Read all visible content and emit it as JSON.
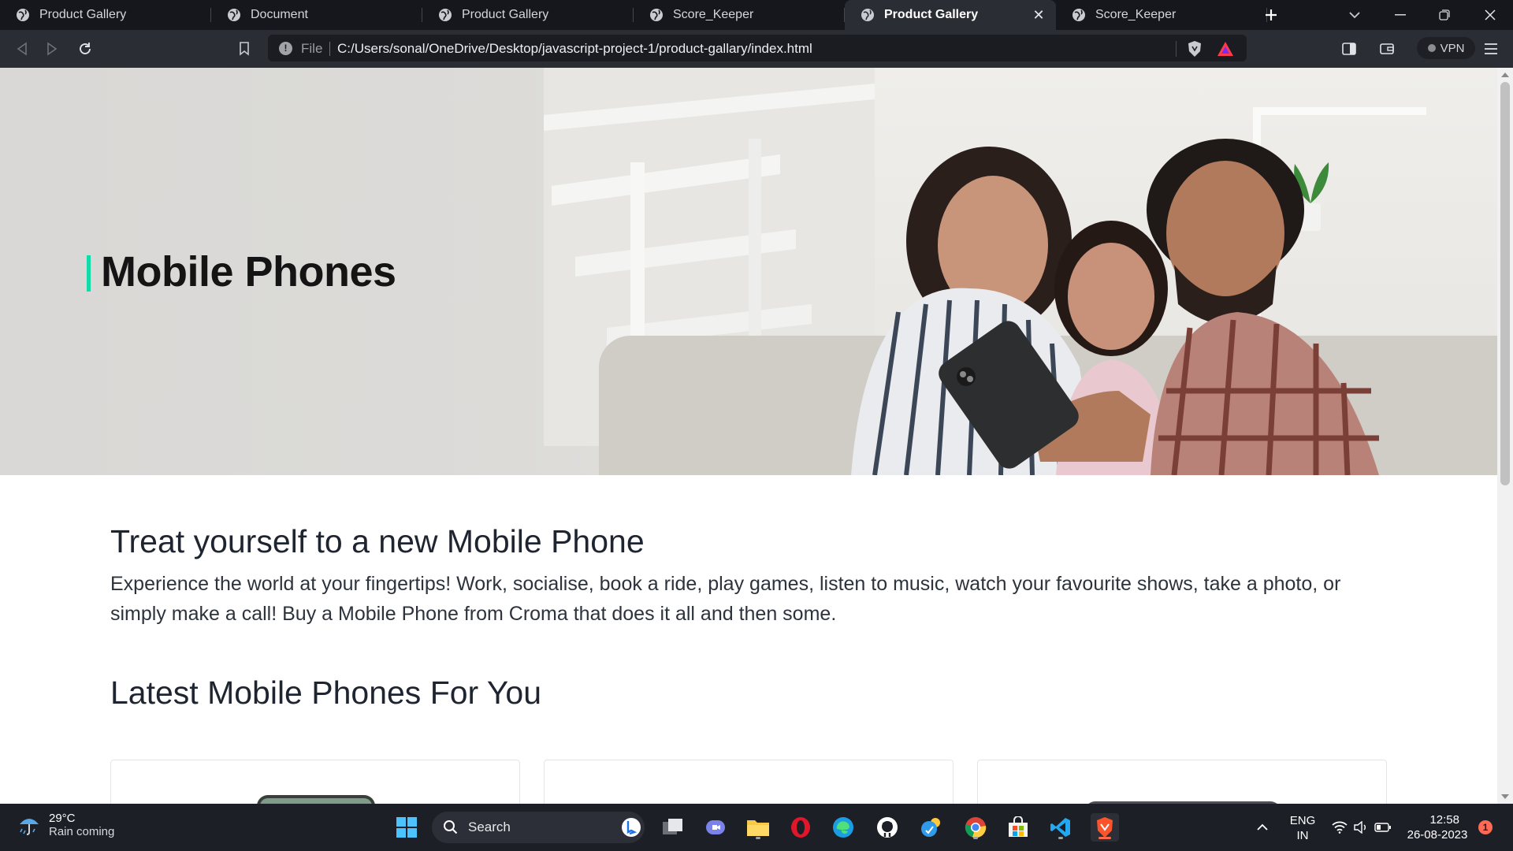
{
  "browser": {
    "tabs": [
      {
        "title": "Product Gallery",
        "active": false
      },
      {
        "title": "Document",
        "active": false
      },
      {
        "title": "Product Gallery",
        "active": false
      },
      {
        "title": "Score_Keeper",
        "active": false
      },
      {
        "title": "Product Gallery",
        "active": true
      },
      {
        "title": "Score_Keeper",
        "active": false
      }
    ],
    "new_tab_icon": "plus-icon",
    "url_scheme": "File",
    "url": "C:/Users/sonal/OneDrive/Desktop/javascript-project-1/product-gallary/index.html",
    "vpn_label": "VPN"
  },
  "page": {
    "hero_title": "Mobile Phones",
    "intro_heading": "Treat yourself to a new Mobile Phone",
    "intro_text": "Experience the world at your fingertips! Work, socialise, book a ride, play games, listen to music, watch your favourite shows, take a photo, or simply make a call! Buy a Mobile Phone from Croma that does it all and then some.",
    "section_heading": "Latest Mobile Phones For You",
    "accent_color": "#12daa8"
  },
  "taskbar": {
    "weather_temp": "29°C",
    "weather_desc": "Rain coming",
    "search_label": "Search",
    "lang_line1": "ENG",
    "lang_line2": "IN",
    "time": "12:58",
    "date": "26-08-2023",
    "notification_count": "1"
  }
}
